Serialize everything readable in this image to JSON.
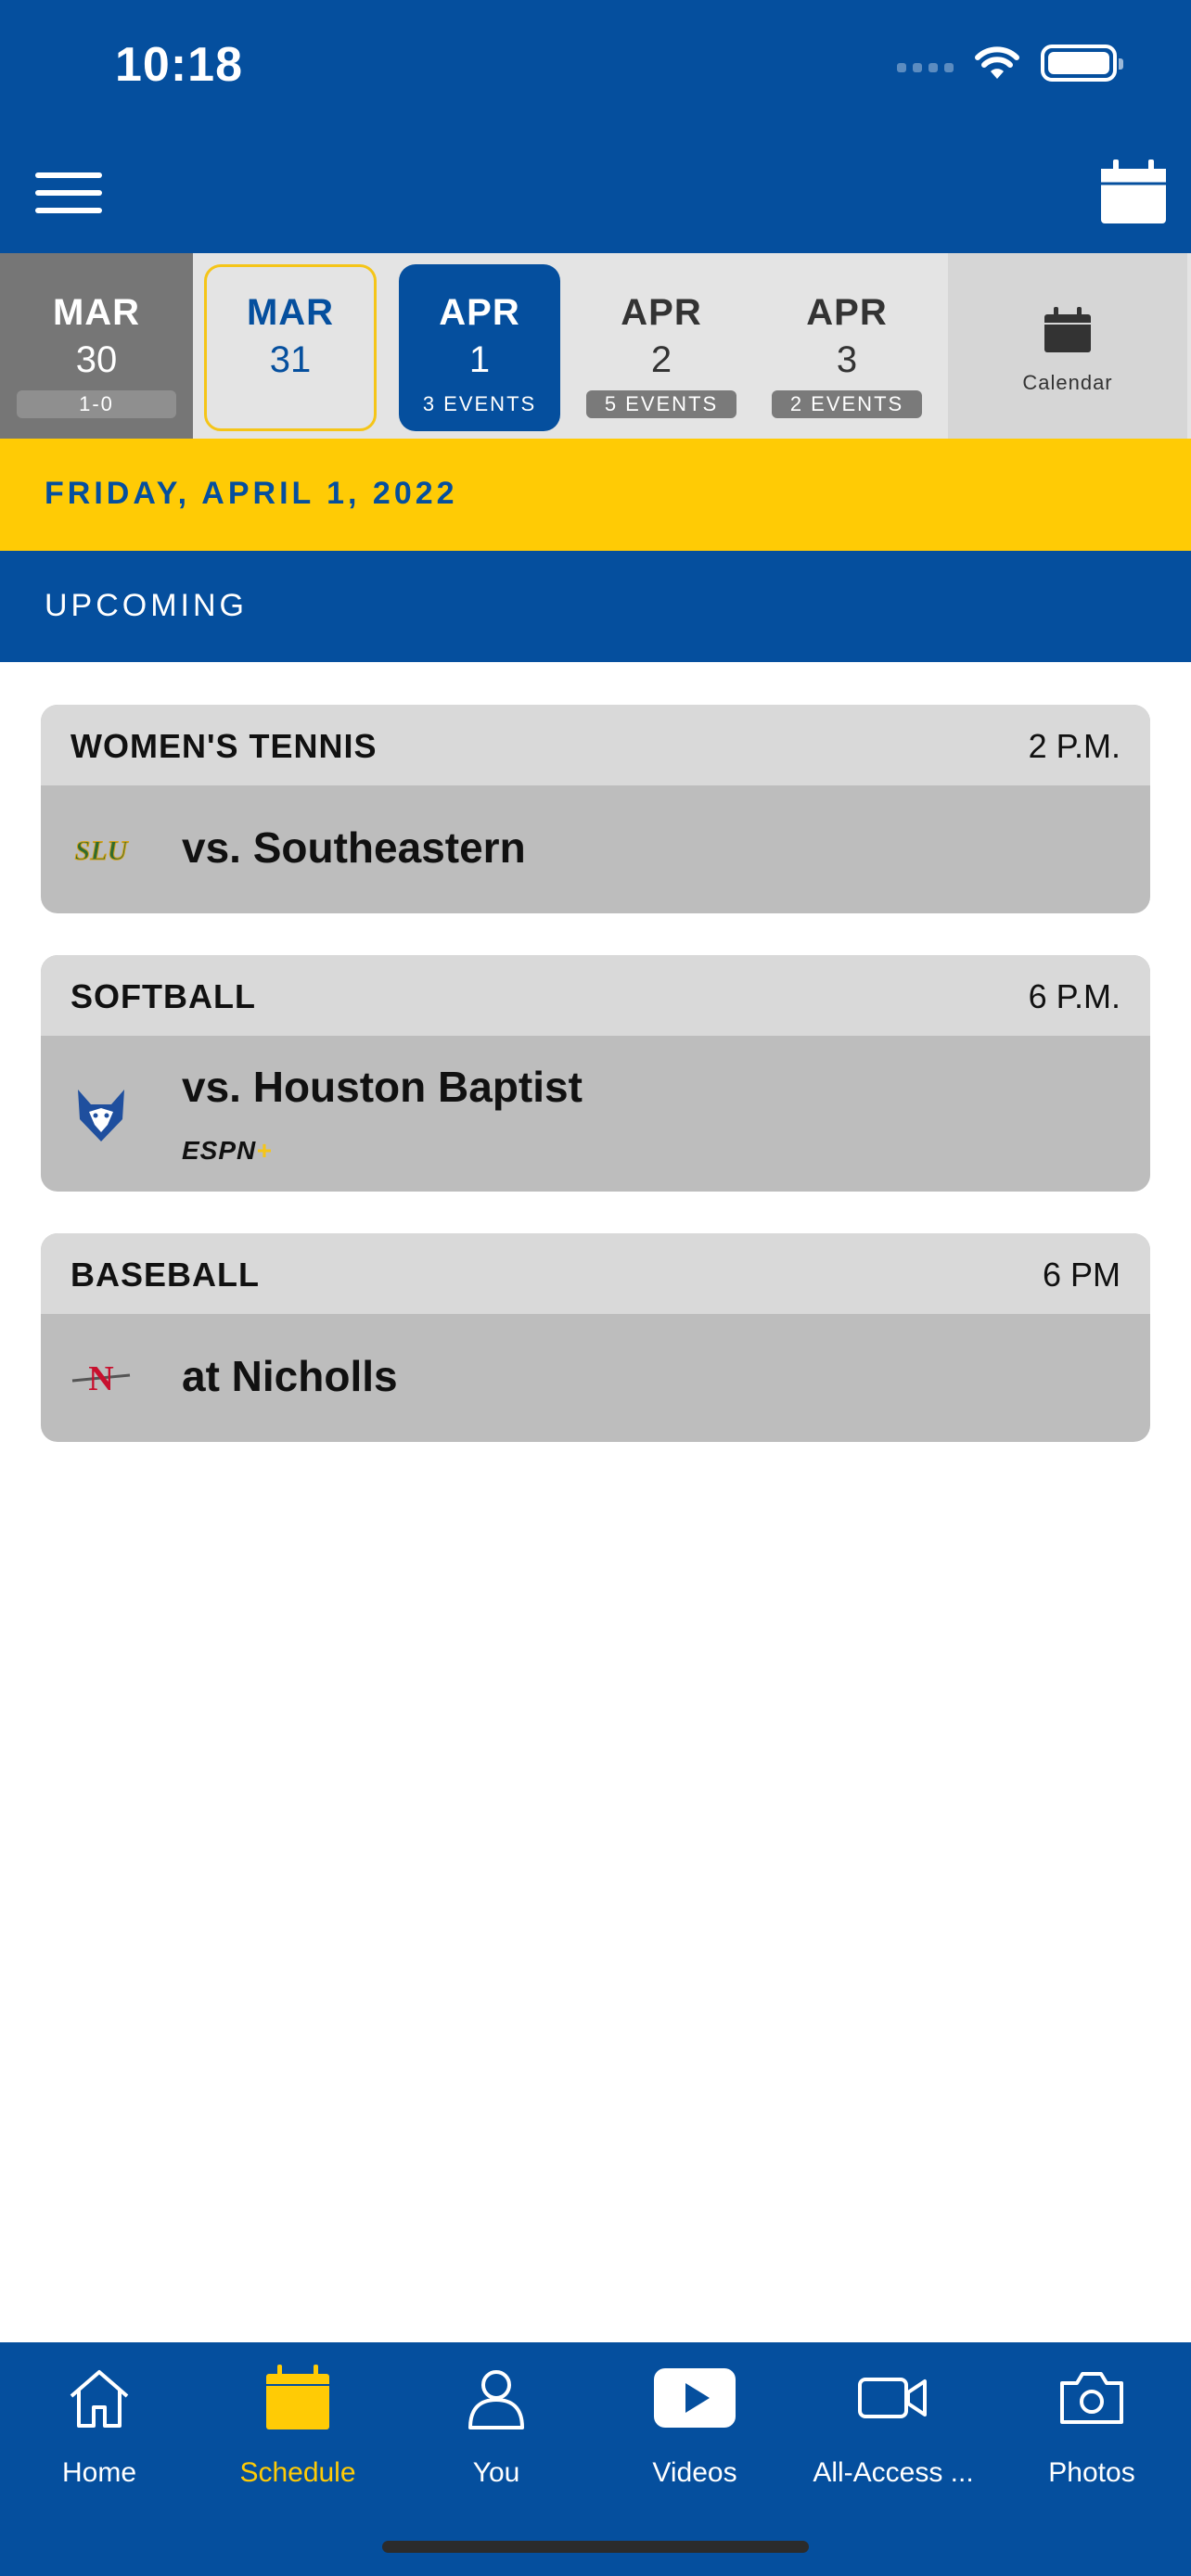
{
  "status_bar": {
    "time": "10:18"
  },
  "date_strip": {
    "days": [
      {
        "month": "MAR",
        "day": "30",
        "events": "1-0"
      },
      {
        "month": "MAR",
        "day": "31",
        "events": ""
      },
      {
        "month": "APR",
        "day": "1",
        "events": "3 EVENTS"
      },
      {
        "month": "APR",
        "day": "2",
        "events": "5 EVENTS"
      },
      {
        "month": "APR",
        "day": "3",
        "events": "2 EVENTS"
      }
    ],
    "calendar_label": "Calendar"
  },
  "date_banner": "FRIDAY, APRIL 1, 2022",
  "section_banner": "UPCOMING",
  "events": [
    {
      "sport": "WOMEN'S TENNIS",
      "time": "2 P.M.",
      "opponent": "vs. Southeastern",
      "logo": "southeastern-logo"
    },
    {
      "sport": "SOFTBALL",
      "time": "6 P.M.",
      "opponent": "vs. Houston Baptist",
      "logo": "houston-baptist-logo",
      "broadcast": "ESPN",
      "broadcast_plus": "+"
    },
    {
      "sport": "BASEBALL",
      "time": "6 PM",
      "opponent": "at Nicholls",
      "logo": "nicholls-logo"
    }
  ],
  "tab_bar": {
    "tabs": [
      {
        "label": "Home",
        "icon": "home-icon"
      },
      {
        "label": "Schedule",
        "icon": "calendar-icon",
        "active": true
      },
      {
        "label": "You",
        "icon": "person-icon"
      },
      {
        "label": "Videos",
        "icon": "play-icon"
      },
      {
        "label": "All-Access ...",
        "icon": "video-camera-icon"
      },
      {
        "label": "Photos",
        "icon": "camera-icon"
      }
    ]
  },
  "colors": {
    "brand_blue": "#054F9E",
    "brand_gold": "#FFCB05"
  }
}
